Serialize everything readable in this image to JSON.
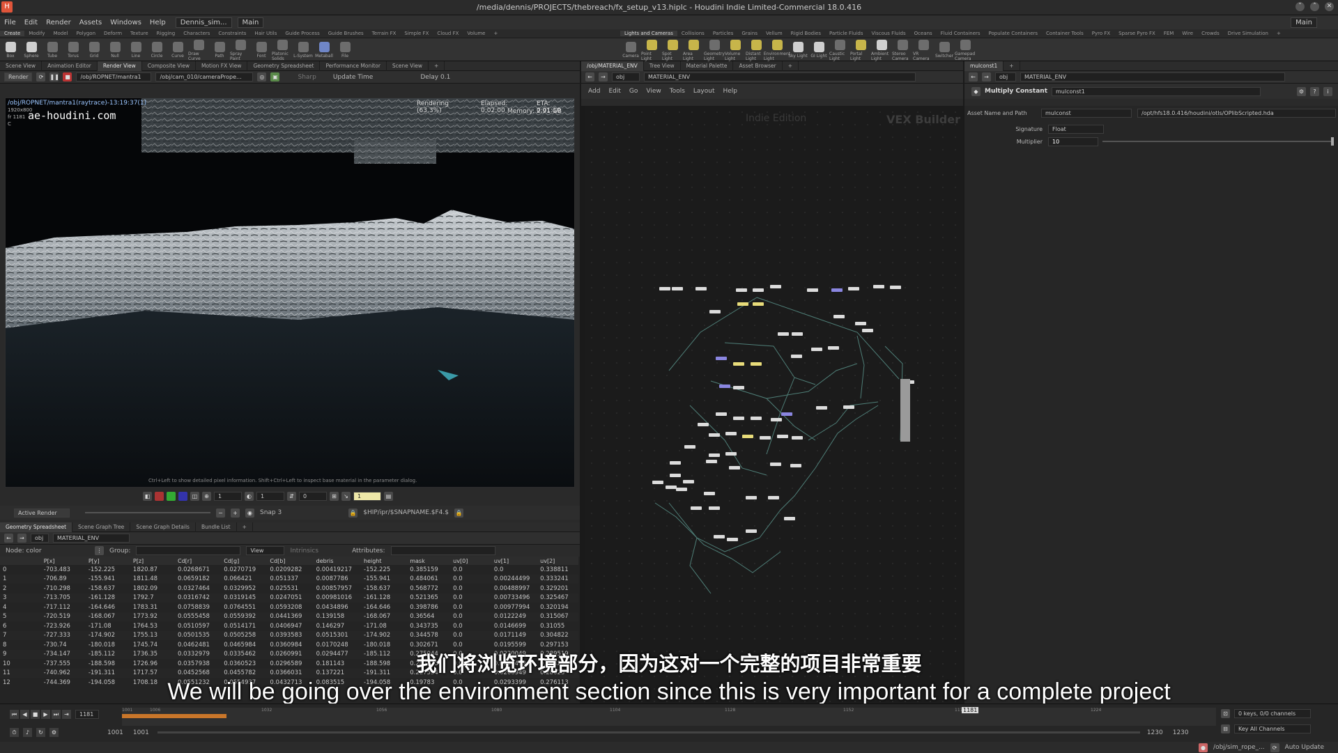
{
  "window": {
    "title": "/media/dennis/PROJECTS/thebreach/fx_setup_v13.hiplc - Houdini Indie Limited-Commercial 18.0.416",
    "logo_letter": "H",
    "min": "˅",
    "restore": "˄",
    "close": "✕"
  },
  "menu": {
    "items": [
      "File",
      "Edit",
      "Render",
      "Assets",
      "Windows",
      "Help"
    ],
    "desktop_combo": "Dennis_sim...",
    "context_combo": "Main",
    "right_combo": "Main"
  },
  "shelf_tabs_left": [
    "Create",
    "Modify",
    "Model",
    "Polygon",
    "Deform",
    "Texture",
    "Rigging",
    "Characters",
    "Constraints",
    "Hair Utils",
    "Guide Process",
    "Guide Brushes",
    "Terrain FX",
    "Simple FX",
    "Cloud FX",
    "Volume",
    "+"
  ],
  "shelf_tabs_right": [
    "Lights and Cameras",
    "Collisions",
    "Particles",
    "Grains",
    "Vellum",
    "Rigid Bodies",
    "Particle Fluids",
    "Viscous Fluids",
    "Oceans",
    "Fluid Containers",
    "Populate Containers",
    "Container Tools",
    "Pyro FX",
    "Sparse Pyro FX",
    "FEM",
    "Wire",
    "Crowds",
    "Drive Simulation",
    "+"
  ],
  "tools_left": [
    "Box",
    "Sphere",
    "Tube",
    "Torus",
    "Grid",
    "Null",
    "Line",
    "Circle",
    "Curve",
    "Draw Curve",
    "Path",
    "Spray Paint",
    "Font",
    "Platonic Solids",
    "L-System",
    "Metaball",
    "File"
  ],
  "tools_right": [
    "Camera",
    "Point Light",
    "Spot Light",
    "Area Light",
    "Geometry Light",
    "Volume Light",
    "Distant Light",
    "Environment Light",
    "Sky Light",
    "GI Light",
    "Caustic Light",
    "Portal Light",
    "Ambient Light",
    "Stereo Camera",
    "VR Camera",
    "Switcher",
    "Gamepad Camera"
  ],
  "viewer": {
    "tabs": [
      "Scene View",
      "Animation Editor",
      "Render View",
      "Composite View",
      "Motion FX View",
      "Geometry Spreadsheet",
      "Performance Monitor",
      "Scene View",
      "+"
    ],
    "render_btn": "Render",
    "rop_path": "/obj/ROPNET/mantra1",
    "camera_path": "/obj/cam_010/cameraPrope...",
    "sharp": "Sharp",
    "update_time": "Update Time",
    "delay": "Delay  0.1",
    "image_info": "/obj/ROPNET/mantra1(raytrace)-13:19:37(1)",
    "resolution": "1920x800",
    "frame_label": "fr 1181",
    "channel": "C",
    "watermark": "ae-houdini.com",
    "rendering": "Rendering (63.3%)",
    "elapsed": "Elapsed: 0:02:00",
    "eta": "ETA: 0:01:10",
    "memory": "Memory:     2.91 GB",
    "hint": "Ctrl+Left to show detailed pixel information.  Shift+Ctrl+Left to inspect base material in the parameter dialog.",
    "bottom": {
      "field1": "1",
      "field2": "1",
      "field3": "0",
      "field4": "1",
      "active_render": "Active Render",
      "snap": "Snap  3",
      "ship_path": "$HIP/ipr/$SNAPNAME.$F4.$"
    }
  },
  "spreadsheet": {
    "tabs": [
      "Geometry Spreadsheet",
      "Scene Graph Tree",
      "Scene Graph Details",
      "Bundle List",
      "+"
    ],
    "path_root": "obj",
    "path_node": "MATERIAL_ENV",
    "node_label": "Node: color",
    "group_label": "Group:",
    "view_label": "View",
    "intrinsics_label": "Intrinsics",
    "attributes_label": "Attributes:",
    "columns": [
      "",
      "P[x]",
      "P[y]",
      "P[z]",
      "Cd[r]",
      "Cd[g]",
      "Cd[b]",
      "debris",
      "height",
      "mask",
      "uv[0]",
      "uv[1]",
      "uv[2]"
    ],
    "rows": [
      [
        "0",
        "-703.483",
        "-152.225",
        "1820.87",
        "0.0268671",
        "0.0270719",
        "0.0209282",
        "0.00419217",
        "-152.225",
        "0.385159",
        "0.0",
        "0.0",
        "0.338811"
      ],
      [
        "1",
        "-706.89",
        "-155.941",
        "1811.48",
        "0.0659182",
        "0.066421",
        "0.051337",
        "0.0087786",
        "-155.941",
        "0.484061",
        "0.0",
        "0.00244499",
        "0.333241"
      ],
      [
        "2",
        "-710.298",
        "-158.637",
        "1802.09",
        "0.0327464",
        "0.0329952",
        "0.025531",
        "0.00857957",
        "-158.637",
        "0.568772",
        "0.0",
        "0.00488997",
        "0.329201"
      ],
      [
        "3",
        "-713.705",
        "-161.128",
        "1792.7",
        "0.0316742",
        "0.0319145",
        "0.0247051",
        "0.00981016",
        "-161.128",
        "0.521365",
        "0.0",
        "0.00733496",
        "0.325467"
      ],
      [
        "4",
        "-717.112",
        "-164.646",
        "1783.31",
        "0.0758839",
        "0.0764551",
        "0.0593208",
        "0.0434896",
        "-164.646",
        "0.398786",
        "0.0",
        "0.00977994",
        "0.320194"
      ],
      [
        "5",
        "-720.519",
        "-168.067",
        "1773.92",
        "0.0555458",
        "0.0559392",
        "0.0441369",
        "0.139158",
        "-168.067",
        "0.36564",
        "0.0",
        "0.0122249",
        "0.315067"
      ],
      [
        "6",
        "-723.926",
        "-171.08",
        "1764.53",
        "0.0510597",
        "0.0514171",
        "0.0406947",
        "0.146297",
        "-171.08",
        "0.343735",
        "0.0",
        "0.0146699",
        "0.31055"
      ],
      [
        "7",
        "-727.333",
        "-174.902",
        "1755.13",
        "0.0501535",
        "0.0505258",
        "0.0393583",
        "0.0515301",
        "-174.902",
        "0.344578",
        "0.0",
        "0.0171149",
        "0.304822"
      ],
      [
        "8",
        "-730.74",
        "-180.018",
        "1745.74",
        "0.0462481",
        "0.0465984",
        "0.0360984",
        "0.0170248",
        "-180.018",
        "0.302671",
        "0.0",
        "0.0195599",
        "0.297153"
      ],
      [
        "9",
        "-734.147",
        "-185.112",
        "1736.35",
        "0.0332979",
        "0.0335462",
        "0.0260991",
        "0.0294477",
        "-185.112",
        "0.275044",
        "0.0",
        "0.0220049",
        "0.289519"
      ],
      [
        "10",
        "-737.555",
        "-188.598",
        "1726.96",
        "0.0357938",
        "0.0360523",
        "0.0296589",
        "0.181143",
        "-188.598",
        "0.262833",
        "0.0",
        "0.0244499",
        "0.284295"
      ],
      [
        "11",
        "-740.962",
        "-191.311",
        "1717.57",
        "0.0452568",
        "0.0455782",
        "0.0366031",
        "0.137221",
        "-191.311",
        "0.227554",
        "0.0",
        "0.0268949",
        "0.28023"
      ],
      [
        "12",
        "-744.369",
        "-194.058",
        "1708.18",
        "0.0551232",
        "0.0554937",
        "0.0432713",
        "0.083515",
        "-194.058",
        "0.19783",
        "0.0",
        "0.0293399",
        "0.276113"
      ]
    ]
  },
  "network": {
    "tabs": [
      "/obj/MATERIAL_ENV",
      "Tree View",
      "Material Palette",
      "Asset Browser",
      "+"
    ],
    "path_root": "obj",
    "path_node": "MATERIAL_ENV",
    "menu": [
      "Add",
      "Edit",
      "Go",
      "View",
      "Tools",
      "Layout",
      "Help"
    ],
    "indie_label": "Indie Edition",
    "builder_label": "VEX Builder"
  },
  "parameters": {
    "tabs": [
      "mulconst1",
      "+"
    ],
    "path_root": "obj",
    "path_node": "MATERIAL_ENV",
    "node_type": "Multiply Constant",
    "node_name": "mulconst1",
    "asset_label": "Asset Name and Path",
    "asset_name": "mulconst",
    "asset_path": "/opt/hfs18.0.416/houdini/otls/OPlibScripted.hda",
    "signature_label": "Signature",
    "signature_value": "Float",
    "multiplier_label": "Multiplier",
    "multiplier_value": "10"
  },
  "subtitles": {
    "cn": "我们将浏览环境部分，因为这对一个完整的项目非常重要",
    "en": "We will be going over the environment section since this is very important for a complete project"
  },
  "timeline": {
    "frame": "1181",
    "ticks": [
      "1001",
      "1006",
      "1032",
      "1056",
      "1080",
      "1104",
      "1128",
      "1152",
      "1176",
      "1181",
      "1224"
    ],
    "current_marker": "1181",
    "range_start1": "1001",
    "range_start2": "1001",
    "range_end1": "1230",
    "range_end2": "1230",
    "keys": "0 keys, 0/0 channels",
    "key_all": "Key All Channels",
    "status_path": "/obj/sim_rope_...",
    "auto_update": "Auto Update"
  }
}
